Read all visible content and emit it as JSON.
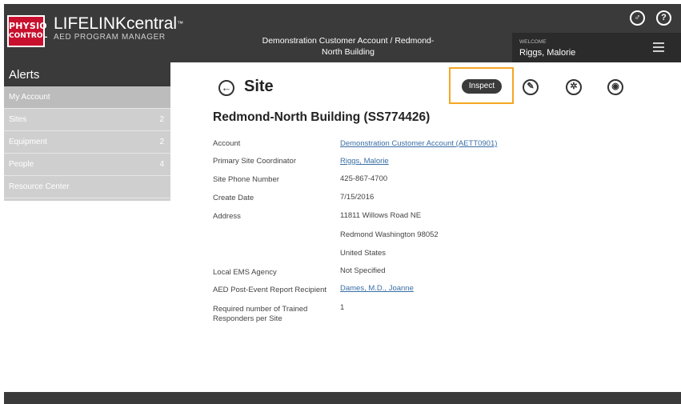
{
  "header": {
    "logo": {
      "line1": "PHYSIO",
      "line2": "CONTROL"
    },
    "brand_title": "LIFELINKcentral",
    "brand_tm": "™",
    "brand_subtitle": "AED PROGRAM MANAGER",
    "account_title_line1": "Demonstration Customer Account / Redmond-",
    "account_title_line2": "North Building",
    "welcome_label": "WELCOME",
    "welcome_name": "Riggs, Malorie",
    "icons": [
      "user-switch-icon",
      "help-icon",
      "menu-icon"
    ]
  },
  "sidebar": {
    "title": "Alerts",
    "items": [
      {
        "label": "My Account",
        "count": ""
      },
      {
        "label": "Sites",
        "count": "2"
      },
      {
        "label": "Equipment",
        "count": "2"
      },
      {
        "label": "People",
        "count": "4"
      },
      {
        "label": "Resource Center",
        "count": ""
      }
    ]
  },
  "main": {
    "page_title": "Site",
    "inspect_label": "Inspect",
    "action_icons": [
      "edit-icon",
      "settings-icon",
      "location-icon"
    ],
    "site_name": "Redmond-North Building (SS774426)",
    "fields": {
      "account_label": "Account",
      "account_value": "Demonstration Customer Account (AETT0901)",
      "coordinator_label": "Primary Site Coordinator",
      "coordinator_value": "Riggs, Malorie",
      "phone_label": "Site Phone Number",
      "phone_value": "425-867-4700",
      "create_date_label": "Create Date",
      "create_date_value": "7/15/2016",
      "address_label": "Address",
      "address_line1": "11811 Willows Road NE",
      "address_line2": "Redmond Washington 98052",
      "address_line3": "United States",
      "ems_label": "Local EMS Agency",
      "ems_value": "Not Specified",
      "report_label": "AED Post-Event Report Recipient",
      "report_value": "Dames, M.D., Joanne",
      "responders_label_line1": "Required number of Trained",
      "responders_label_line2": "Responders per Site",
      "responders_value": "1"
    }
  },
  "colors": {
    "header_bg": "#3a3a3a",
    "sidebar_bg": "#cfcfcf",
    "logo_red": "#c8102e",
    "highlight": "#f5a623",
    "link": "#3a6ea5"
  }
}
